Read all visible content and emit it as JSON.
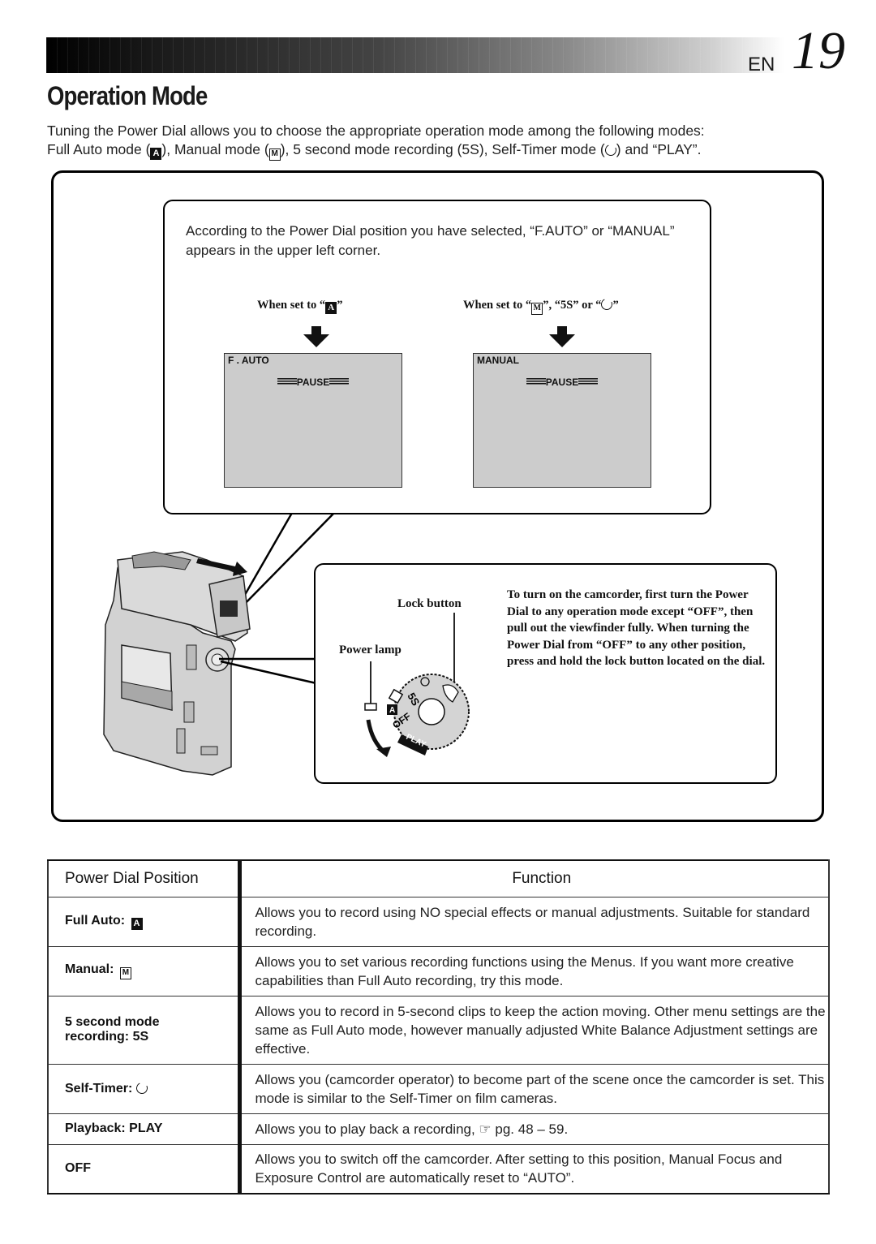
{
  "header": {
    "lang": "EN",
    "page_number": "19"
  },
  "title": "Operation Mode",
  "intro": {
    "line1": "Tuning the Power Dial allows you to choose the appropriate operation mode among the following modes:",
    "line2_parts": {
      "a": "Full Auto mode (",
      "b": "), Manual mode (",
      "c": "), 5 second mode recording (5S), Self-Timer mode (",
      "d": ") and “PLAY”."
    }
  },
  "icons": {
    "auto": "A",
    "manual": "M"
  },
  "callout_top": {
    "text": "According to the Power Dial position you have selected, “F.AUTO” or “MANUAL” appears in the upper left corner.",
    "left_label_prefix": "When set to “",
    "left_label_suffix": "”",
    "right_label_prefix": "When set to “",
    "right_label_mid": "”, “5S” or “",
    "right_label_suffix": "”",
    "screens": [
      {
        "mode": "F . AUTO",
        "status": "PAUSE"
      },
      {
        "mode": "MANUAL",
        "status": "PAUSE"
      }
    ]
  },
  "callout_bottom": {
    "lock_button": "Lock button",
    "power_lamp": "Power lamp",
    "instructions": "To turn on the camcorder, first turn the Power Dial to any operation mode except “OFF”,  then pull out the viewfinder fully. When turning the Power Dial from “OFF” to any other position, press and hold the lock button located on the dial.",
    "dial_labels": [
      "5S",
      "M",
      "A",
      "OFF",
      "PLAY"
    ]
  },
  "table": {
    "headers": [
      "Power Dial Position",
      "Function"
    ],
    "rows": [
      {
        "position": "Full Auto:",
        "icon": "A",
        "function": "Allows you to record using NO special effects or manual adjustments. Suitable for standard recording."
      },
      {
        "position": "Manual:",
        "icon": "M",
        "function": "Allows you to set various recording functions using the Menus. If you want more creative capabilities than Full Auto recording, try this mode."
      },
      {
        "position": "5 second mode recording: 5S",
        "icon": "",
        "function": "Allows you to record in 5-second clips to keep the action moving. Other menu settings are the same as Full Auto mode, however manually adjusted White Balance Adjustment settings are effective."
      },
      {
        "position": "Self-Timer:",
        "icon": "self-timer",
        "function": "Allows you (camcorder operator) to become part of the scene once the camcorder is set. This mode is similar to the Self-Timer on film cameras."
      },
      {
        "position": "Playback: PLAY",
        "icon": "",
        "function_prefix": "Allows you to play back a recording, ",
        "function_ref": "☞",
        "function_suffix": " pg. 48 – 59."
      },
      {
        "position": "OFF",
        "icon": "",
        "function": "Allows you to switch off the camcorder. After setting to this position, Manual Focus and Exposure Control are automatically reset to “AUTO”."
      }
    ]
  }
}
